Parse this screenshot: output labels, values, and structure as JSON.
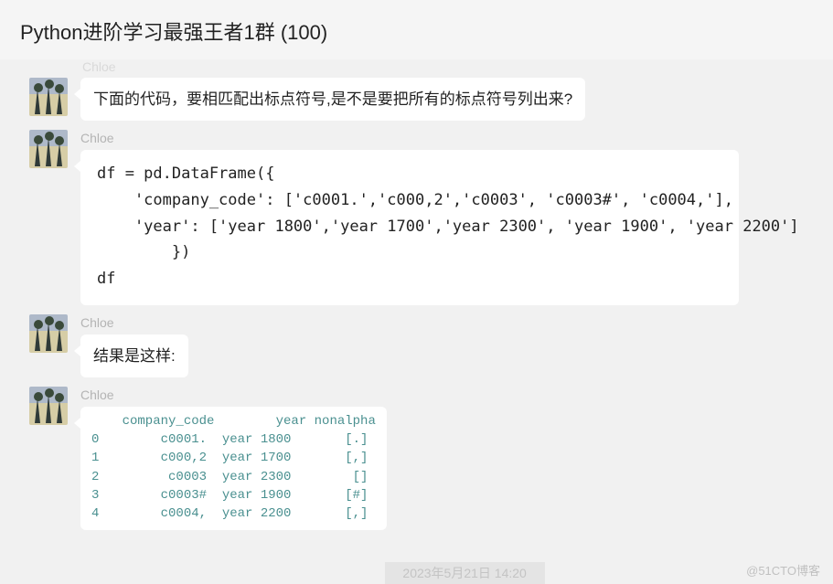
{
  "header": {
    "title": "Python进阶学习最强王者1群 (100)"
  },
  "messages": [
    {
      "sender": "Chloe",
      "type": "text",
      "text": "下面的代码，要相匹配出标点符号,是不是要把所有的标点符号列出来?"
    },
    {
      "sender": "Chloe",
      "type": "code",
      "code": "df = pd.DataFrame({\n    'company_code': ['c0001.','c000,2','c0003', 'c0003#', 'c0004,'],\n    'year': ['year 1800','year 1700','year 2300', 'year 1900', 'year 2200']\n        })\ndf"
    },
    {
      "sender": "Chloe",
      "type": "text",
      "text": "结果是这样:"
    },
    {
      "sender": "Chloe",
      "type": "table",
      "table": {
        "columns": [
          "company_code",
          "year",
          "nonalpha"
        ],
        "rows": [
          {
            "idx": "0",
            "company_code": "c0001.",
            "year": "year 1800",
            "nonalpha": "[.]"
          },
          {
            "idx": "1",
            "company_code": "c000,2",
            "year": "year 1700",
            "nonalpha": "[,]"
          },
          {
            "idx": "2",
            "company_code": "c0003",
            "year": "year 2300",
            "nonalpha": "[]"
          },
          {
            "idx": "3",
            "company_code": "c0003#",
            "year": "year 1900",
            "nonalpha": "[#]"
          },
          {
            "idx": "4",
            "company_code": "c0004,",
            "year": "year 2200",
            "nonalpha": "[,]"
          }
        ]
      }
    }
  ],
  "partial_top_sender": "Chloe",
  "watermark": "@51CTO博客",
  "timestamp_hint": "2023年5月21日  14:20"
}
